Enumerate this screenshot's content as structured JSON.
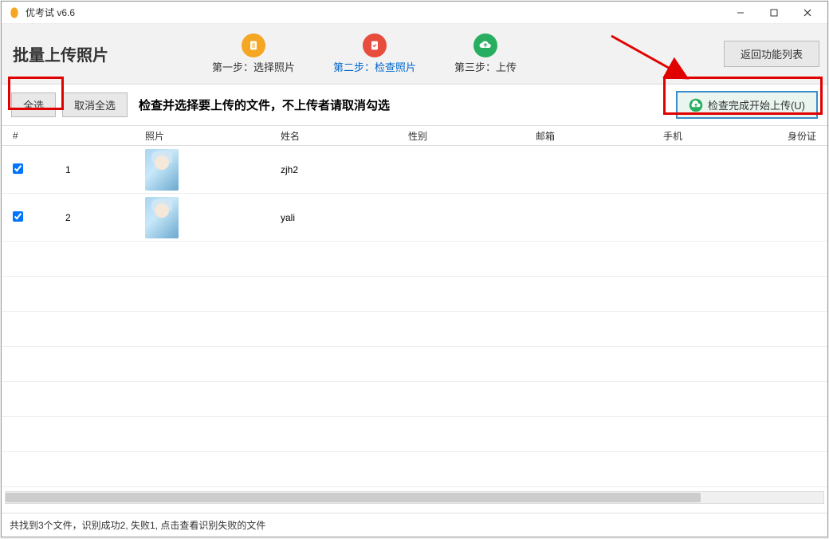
{
  "window": {
    "title": "优考试 v6.6"
  },
  "header": {
    "page_title": "批量上传照片",
    "return_label": "返回功能列表"
  },
  "steps": {
    "step1": "第一步：选择照片",
    "step2": "第二步：检查照片",
    "step3": "第三步：上传"
  },
  "toolbar": {
    "select_all": "全选",
    "deselect_all": "取消全选",
    "instruction": "检查并选择要上传的文件，不上传者请取消勾选",
    "upload_btn": "检查完成开始上传(U)"
  },
  "table": {
    "headers": {
      "hash": "#",
      "photo": "照片",
      "name": "姓名",
      "gender": "性别",
      "email": "邮箱",
      "phone": "手机",
      "id_card": "身份证"
    },
    "rows": [
      {
        "num": "1",
        "name": "zjh2",
        "gender": "",
        "email": "",
        "phone": "",
        "id_card": ""
      },
      {
        "num": "2",
        "name": "yali",
        "gender": "",
        "email": "",
        "phone": "",
        "id_card": ""
      }
    ]
  },
  "status": {
    "text": "共找到3个文件，识别成功2, 失败1, 点击查看识别失败的文件"
  }
}
